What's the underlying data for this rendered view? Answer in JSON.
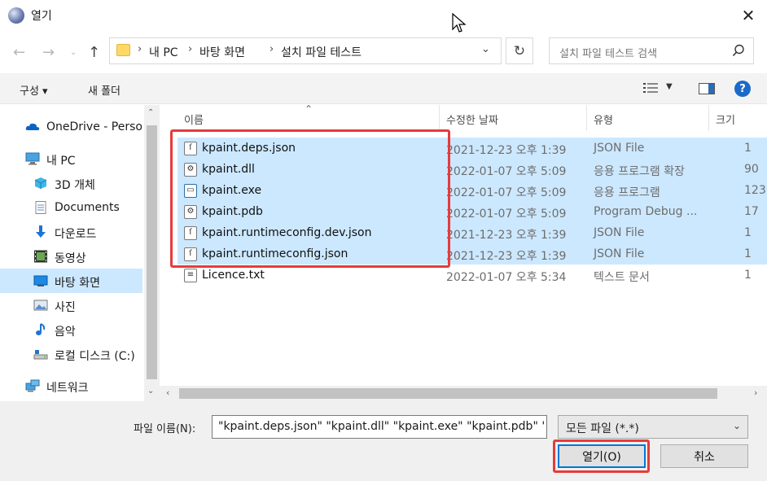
{
  "window": {
    "title": "열기"
  },
  "address": {
    "crumbs": [
      "내 PC",
      "바탕 화면",
      "설치 파일 테스트"
    ]
  },
  "search": {
    "placeholder": "설치 파일 테스트 검색"
  },
  "toolbar": {
    "organize": "구성 ▾",
    "new_folder": "새 폴더"
  },
  "sidebar": {
    "items": [
      {
        "label": "OneDrive - Person",
        "icon": "cloud-icon"
      },
      {
        "label": "내 PC",
        "icon": "computer-icon"
      },
      {
        "label": "3D 개체",
        "icon": "cube-icon"
      },
      {
        "label": "Documents",
        "icon": "document-icon"
      },
      {
        "label": "다운로드",
        "icon": "download-arrow-icon"
      },
      {
        "label": "동영상",
        "icon": "film-icon"
      },
      {
        "label": "바탕 화면",
        "icon": "desktop-icon",
        "selected": true
      },
      {
        "label": "사진",
        "icon": "picture-icon"
      },
      {
        "label": "음악",
        "icon": "music-note-icon"
      },
      {
        "label": "로컬 디스크 (C:)",
        "icon": "drive-icon"
      },
      {
        "label": "네트워크",
        "icon": "network-icon"
      }
    ]
  },
  "columns": {
    "name": "이름",
    "date": "수정한 날짜",
    "type": "유형",
    "size": "크기"
  },
  "files": [
    {
      "name": "kpaint.deps.json",
      "date": "2021-12-23 오후 1:39",
      "type": "JSON File",
      "size": "1",
      "selected": true,
      "icon": "json-file-icon"
    },
    {
      "name": "kpaint.dll",
      "date": "2022-01-07 오후 5:09",
      "type": "응용 프로그램 확장",
      "size": "90",
      "selected": true,
      "icon": "dll-file-icon"
    },
    {
      "name": "kpaint.exe",
      "date": "2022-01-07 오후 5:09",
      "type": "응용 프로그램",
      "size": "123",
      "selected": true,
      "icon": "exe-file-icon"
    },
    {
      "name": "kpaint.pdb",
      "date": "2022-01-07 오후 5:09",
      "type": "Program Debug ...",
      "size": "17",
      "selected": true,
      "icon": "pdb-file-icon"
    },
    {
      "name": "kpaint.runtimeconfig.dev.json",
      "date": "2021-12-23 오후 1:39",
      "type": "JSON File",
      "size": "1",
      "selected": true,
      "icon": "json-file-icon"
    },
    {
      "name": "kpaint.runtimeconfig.json",
      "date": "2021-12-23 오후 1:39",
      "type": "JSON File",
      "size": "1",
      "selected": true,
      "icon": "json-file-icon"
    },
    {
      "name": "Licence.txt",
      "date": "2022-01-07 오후 5:34",
      "type": "텍스트 문서",
      "size": "1",
      "selected": false,
      "icon": "text-file-icon"
    }
  ],
  "footer": {
    "filename_label": "파일 이름(N):",
    "filename_value": "\"kpaint.deps.json\" \"kpaint.dll\" \"kpaint.exe\" \"kpaint.pdb\" \"",
    "filetype_value": "모든 파일 (*.*)",
    "open_label": "열기(O)",
    "cancel_label": "취소"
  },
  "colors": {
    "selection": "#cce8ff",
    "highlight_box": "#e63b3b",
    "accent": "#0078d7"
  }
}
